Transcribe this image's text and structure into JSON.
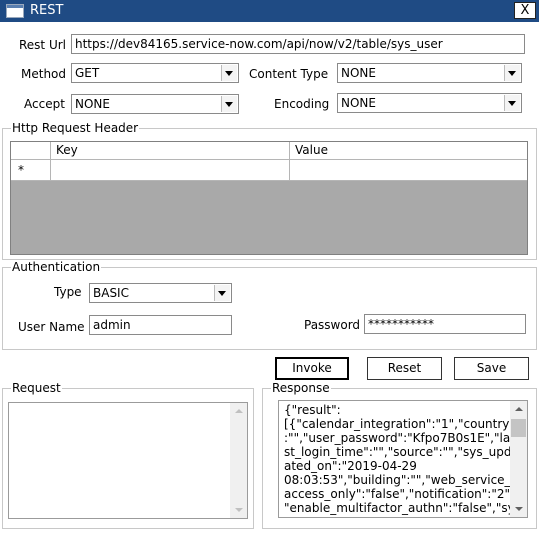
{
  "window": {
    "title": "REST",
    "close_label": "X"
  },
  "request_form": {
    "rest_url_label": "Rest Url",
    "rest_url_value": "https://dev84165.service-now.com/api/now/v2/table/sys_user",
    "method_label": "Method",
    "method_value": "GET",
    "content_type_label": "Content Type",
    "content_type_value": "NONE",
    "accept_label": "Accept",
    "accept_value": "NONE",
    "encoding_label": "Encoding",
    "encoding_value": "NONE"
  },
  "headers": {
    "legend": "Http Request Header",
    "columns": [
      "Key",
      "Value"
    ],
    "new_row_marker": "*"
  },
  "authentication": {
    "legend": "Authentication",
    "type_label": "Type",
    "type_value": "BASIC",
    "user_name_label": "User Name",
    "user_name_value": "admin",
    "password_label": "Password",
    "password_value": "***********"
  },
  "actions": {
    "invoke": "Invoke",
    "reset": "Reset",
    "save": "Save"
  },
  "request": {
    "legend": "Request",
    "body": ""
  },
  "response": {
    "legend": "Response",
    "lines": [
      "{\"result\":",
      "[{\"calendar_integration\":\"1\",\"country\"",
      ":\"\",\"user_password\":\"Kfpo7B0s1E\",\"la",
      "st_login_time\":\"\",\"source\":\"\",\"sys_upd",
      "ated_on\":\"2019-04-29",
      "08:03:53\",\"building\":\"\",\"web_service_",
      "access_only\":\"false\",\"notification\":\"2\",",
      "\"enable_multifactor_authn\":\"false\",\"sy"
    ]
  },
  "colors": {
    "titlebar": "#1f4b84",
    "grid_background": "#a9a9a9",
    "scrollbar_thumb": "#c4c4c4"
  },
  "icons": {
    "window_icon": "app-window-icon",
    "dropdown": "chevron-down-icon",
    "scroll_up": "arrow-up-icon",
    "scroll_down": "arrow-down-icon"
  }
}
